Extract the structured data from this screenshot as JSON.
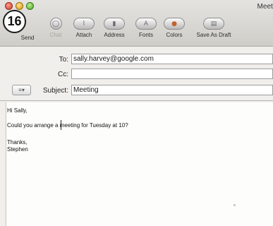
{
  "window": {
    "title": "Meeting",
    "title_visible": "Meeti"
  },
  "callout": {
    "number": "16"
  },
  "toolbar": {
    "buttons": [
      {
        "label": "Send",
        "icon": "send-icon",
        "enabled": true
      },
      {
        "label": "Chat",
        "icon": "chat-icon",
        "enabled": false
      },
      {
        "label": "Attach",
        "icon": "paperclip-icon",
        "enabled": true
      },
      {
        "label": "Address",
        "icon": "address-book-icon",
        "enabled": true
      },
      {
        "label": "Fonts",
        "icon": "fonts-icon",
        "enabled": true
      },
      {
        "label": "Colors",
        "icon": "color-wheel-icon",
        "enabled": true
      },
      {
        "label": "Save As Draft",
        "icon": "save-draft-icon",
        "enabled": true
      }
    ]
  },
  "header": {
    "to_label": "To:",
    "to_value": "sally.harvey@google.com",
    "cc_label": "Cc:",
    "cc_value": "",
    "subject_label": "Subject:",
    "subject_value": "Meeting",
    "account_menu": "≡▾"
  },
  "message": {
    "lines": [
      "Hi Sally,",
      "Could you arrange a meeting for Tuesday at 10?",
      "Thanks,",
      "Stephen"
    ]
  }
}
